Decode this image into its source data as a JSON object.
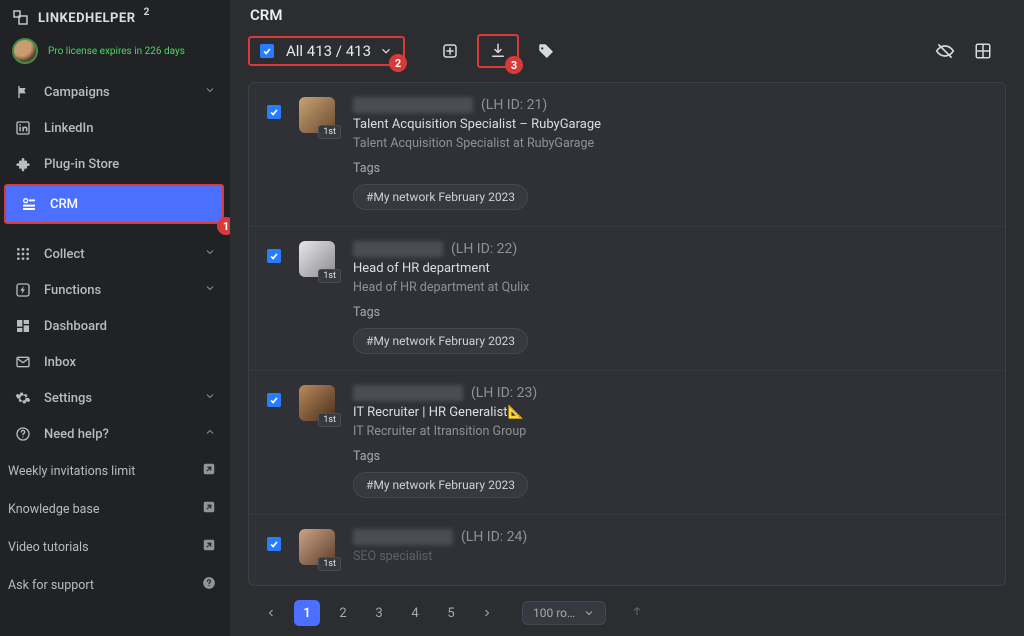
{
  "brand": {
    "name": "LINKEDHELPER",
    "sup": "2"
  },
  "profile": {
    "license_text": "Pro license expires in 226 days"
  },
  "nav": {
    "campaigns": "Campaigns",
    "linkedin": "LinkedIn",
    "plugin": "Plug-in Store",
    "crm": "CRM",
    "collect": "Collect",
    "functions": "Functions",
    "dashboard": "Dashboard",
    "inbox": "Inbox",
    "settings": "Settings",
    "help": "Need help?"
  },
  "help_items": {
    "weekly": "Weekly invitations limit",
    "kb": "Knowledge base",
    "video": "Video tutorials",
    "ask": "Ask for support"
  },
  "annotations": {
    "one": "1",
    "two": "2",
    "three": "3"
  },
  "header": {
    "title": "CRM"
  },
  "toolbar": {
    "select_all_label": "All 413 / 413"
  },
  "contacts": [
    {
      "lh_id": "(LH ID: 21)",
      "conn": "1st",
      "title": "Talent Acquisition Specialist – RubyGarage",
      "subtitle": "Talent Acquisition Specialist at RubyGarage",
      "tags_label": "Tags",
      "tag": "#My network February 2023"
    },
    {
      "lh_id": "(LH ID: 22)",
      "conn": "1st",
      "title": "Head of HR department",
      "subtitle": "Head of HR department at Qulix",
      "tags_label": "Tags",
      "tag": "#My network February 2023"
    },
    {
      "lh_id": "(LH ID: 23)",
      "conn": "1st",
      "title": "IT Recruiter | HR Generalist📐",
      "subtitle": "IT Recruiter at Itransition Group",
      "tags_label": "Tags",
      "tag": "#My network February 2023"
    },
    {
      "lh_id": "(LH ID: 24)",
      "conn": "1st",
      "title": "SEO specialist",
      "subtitle": "",
      "tags_label": "",
      "tag": ""
    }
  ],
  "pager": {
    "pages": [
      "1",
      "2",
      "3",
      "4",
      "5"
    ],
    "page_size_label": "100  ro…"
  }
}
